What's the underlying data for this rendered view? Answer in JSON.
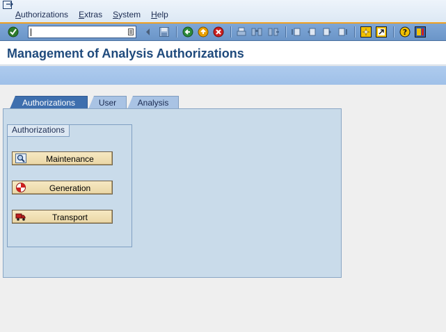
{
  "menu": {
    "items": [
      "Authorizations",
      "Extras",
      "System",
      "Help"
    ]
  },
  "toolbar": {
    "command_field_value": "",
    "icons": [
      "enter-icon",
      "save-icon",
      "back-icon",
      "exit-icon",
      "cancel-icon",
      "print-icon",
      "find-icon",
      "find-next-icon",
      "first-page-icon",
      "previous-page-icon",
      "next-page-icon",
      "last-page-icon",
      "create-session-icon",
      "shortcut-icon",
      "help-icon",
      "layout-menu-icon"
    ]
  },
  "title": "Management of Analysis Authorizations",
  "tabs": [
    {
      "label": "Authorizations",
      "active": true
    },
    {
      "label": "User",
      "active": false
    },
    {
      "label": "Analysis",
      "active": false
    }
  ],
  "group": {
    "title": "Authorizations",
    "buttons": [
      {
        "label": "Maintenance",
        "icon": "magnifier-icon"
      },
      {
        "label": "Generation",
        "icon": "generate-icon"
      },
      {
        "label": "Transport",
        "icon": "truck-icon"
      }
    ]
  },
  "colors": {
    "toolbar": "#7ea6d6",
    "title_text": "#1f4a7c",
    "tab_active": "#3e6fae",
    "panel": "#c9dbea",
    "button": "#f0e0b5",
    "menu_underline": "#f0a020"
  }
}
